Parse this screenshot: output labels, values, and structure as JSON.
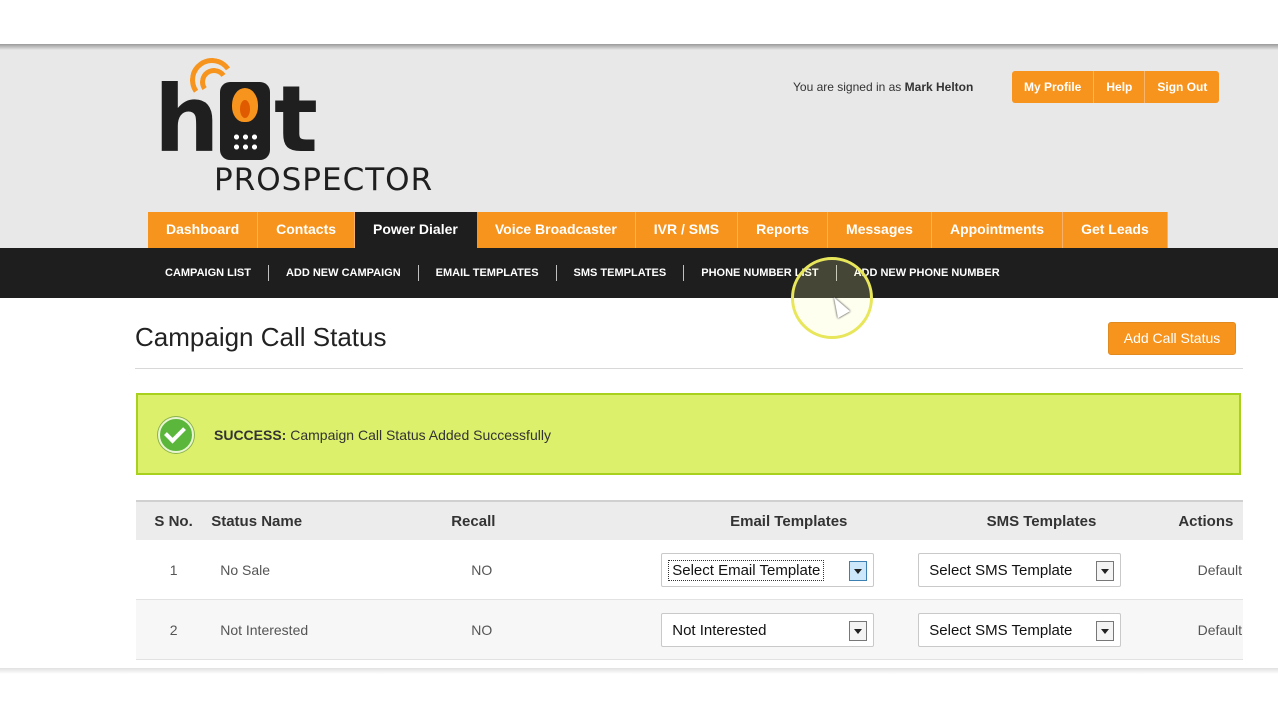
{
  "header": {
    "logo": {
      "word_h": "h",
      "word_t": "t",
      "sub": "PROSPECTOR"
    },
    "signed_in_prefix": "You are signed in as",
    "user_name": "Mark Helton",
    "user_buttons": [
      "My Profile",
      "Help",
      "Sign Out"
    ]
  },
  "main_nav": {
    "tabs": [
      "Dashboard",
      "Contacts",
      "Power Dialer",
      "Voice Broadcaster",
      "IVR / SMS",
      "Reports",
      "Messages",
      "Appointments",
      "Get Leads"
    ],
    "active": "Power Dialer"
  },
  "sub_nav": {
    "items": [
      "CAMPAIGN LIST",
      "ADD NEW CAMPAIGN",
      "EMAIL TEMPLATES",
      "SMS TEMPLATES",
      "PHONE NUMBER LIST",
      "ADD NEW PHONE NUMBER"
    ]
  },
  "page": {
    "title": "Campaign Call Status",
    "add_button": "Add Call Status"
  },
  "alert": {
    "label": "SUCCESS:",
    "message": "Campaign Call Status Added Successfully"
  },
  "table": {
    "headers": [
      "S No.",
      "Status Name",
      "Recall",
      "Email Templates",
      "SMS Templates",
      "Actions"
    ],
    "rows": [
      {
        "sno": "1",
        "name": "No Sale",
        "recall": "NO",
        "email": "Select Email Template",
        "sms": "Select SMS Template",
        "action": "Default"
      },
      {
        "sno": "2",
        "name": "Not Interested",
        "recall": "NO",
        "email": "Not Interested",
        "sms": "Select SMS Template",
        "action": "Default"
      }
    ]
  },
  "colors": {
    "accent": "#f7941d",
    "dark": "#1e1e1e",
    "success_bg": "#ddf06b",
    "success_border": "#a8d11d"
  }
}
